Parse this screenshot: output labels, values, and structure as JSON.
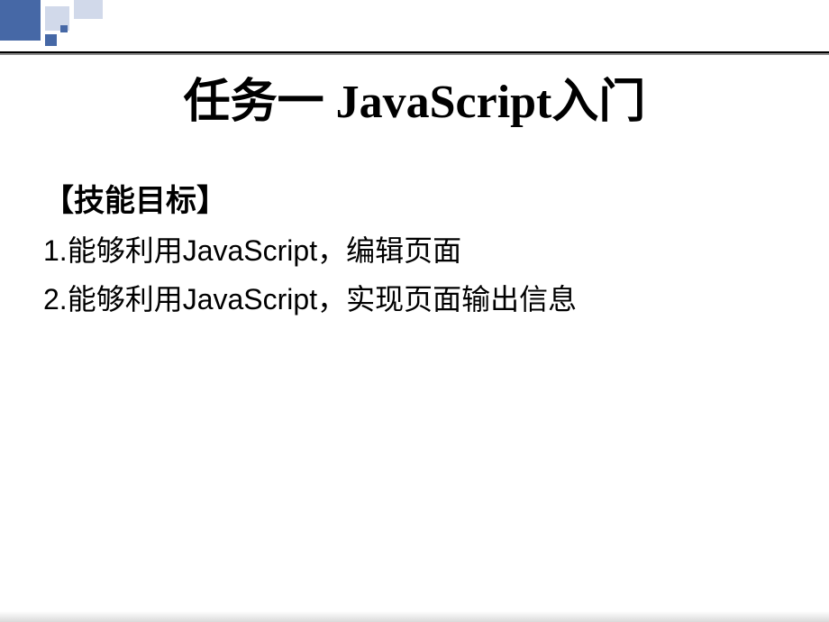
{
  "title": "任务一 JavaScript入门",
  "heading": "【技能目标】",
  "items": [
    "1.能够利用JavaScript，编辑页面",
    "2.能够利用JavaScript，实现页面输出信息"
  ]
}
